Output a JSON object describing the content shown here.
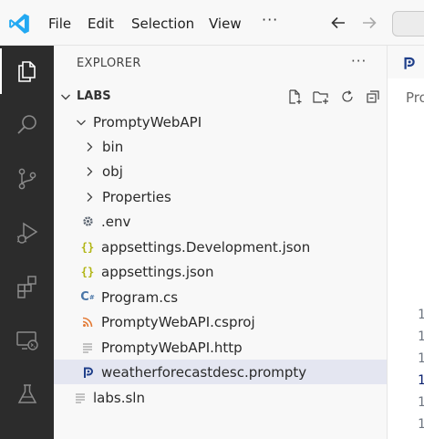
{
  "menu": {
    "file": "File",
    "edit": "Edit",
    "selection": "Selection",
    "view": "View",
    "more": "···"
  },
  "sidebar": {
    "title": "EXPLORER",
    "more": "···",
    "workspace": "LABS",
    "tree": [
      {
        "label": "PromptyWebAPI",
        "kind": "folder",
        "depth": 0,
        "expanded": true,
        "icon": "chevron-down-icon"
      },
      {
        "label": "bin",
        "kind": "folder",
        "depth": 1,
        "expanded": false,
        "icon": "chevron-right-icon"
      },
      {
        "label": "obj",
        "kind": "folder",
        "depth": 1,
        "expanded": false,
        "icon": "chevron-right-icon"
      },
      {
        "label": "Properties",
        "kind": "folder",
        "depth": 1,
        "expanded": false,
        "icon": "chevron-right-icon"
      },
      {
        "label": ".env",
        "kind": "file",
        "depth": 1,
        "icon": "gear-file-icon"
      },
      {
        "label": "appsettings.Development.json",
        "kind": "file",
        "depth": 1,
        "icon": "json-file-icon"
      },
      {
        "label": "appsettings.json",
        "kind": "file",
        "depth": 1,
        "icon": "json-file-icon"
      },
      {
        "label": "Program.cs",
        "kind": "file",
        "depth": 1,
        "icon": "csharp-file-icon"
      },
      {
        "label": "PromptyWebAPI.csproj",
        "kind": "file",
        "depth": 1,
        "icon": "rss-file-icon"
      },
      {
        "label": "PromptyWebAPI.http",
        "kind": "file",
        "depth": 1,
        "icon": "lines-file-icon"
      },
      {
        "label": "weatherforecastdesc.prompty",
        "kind": "file",
        "depth": 1,
        "icon": "prompty-file-icon",
        "selected": true
      },
      {
        "label": "labs.sln",
        "kind": "file",
        "depth": 0,
        "icon": "lines-file-icon"
      }
    ]
  },
  "editor": {
    "breadcrumb": "Pro",
    "line_numbers": [
      "1",
      "1",
      "1",
      "1",
      "1",
      "1"
    ]
  },
  "colors": {
    "activity_bar": "#2c2c2c",
    "selected_row": "#e4e6f1",
    "vscode_blue": "#23a9f2",
    "json_yellow": "#b1b514",
    "csharp_blue": "#4a76a8",
    "rss_orange": "#e37933"
  }
}
